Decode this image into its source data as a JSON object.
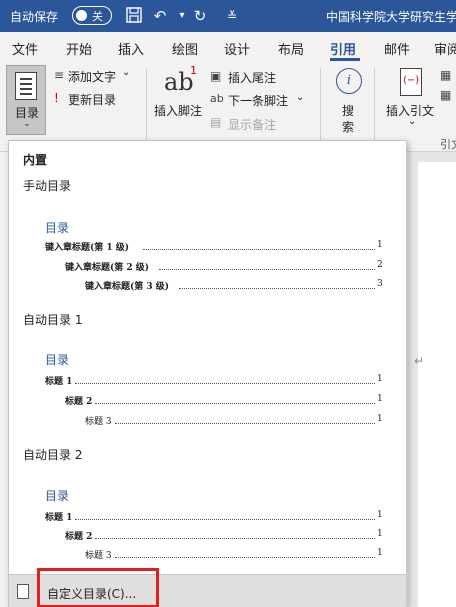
{
  "titlebar": {
    "autosave_label": "自动保存",
    "toggle_label": "关",
    "doc_title": "中国科学院大学研究生学"
  },
  "tabs": [
    "文件",
    "开始",
    "插入",
    "绘图",
    "设计",
    "布局",
    "引用",
    "邮件",
    "审阅"
  ],
  "active_tab": "引用",
  "ribbon": {
    "toc_label": "目录",
    "add_text": "添加文字",
    "update_toc": "更新目录",
    "insert_footnote": "插入脚注",
    "insert_endnote": "插入尾注",
    "next_footnote": "下一条脚注",
    "show_notes": "显示备注",
    "search": "搜\n索",
    "search_a": "搜",
    "search_b": "索",
    "insert_citation": "插入引文",
    "cite_group": "引文"
  },
  "gallery": {
    "builtin": "内置",
    "manual": {
      "name": "手动目录",
      "title": "目录",
      "lines": [
        {
          "text": "键入章标题(第 1 级)",
          "page": "1"
        },
        {
          "text": "键入章标题(第 2 级)",
          "page": "2"
        },
        {
          "text": "键入章标题(第 3 级)",
          "page": "3"
        }
      ]
    },
    "auto1": {
      "name": "自动目录 1",
      "title": "目录",
      "lines": [
        {
          "text": "标题 1",
          "page": "1"
        },
        {
          "text": "标题 2",
          "page": "1"
        },
        {
          "text": "标题 3",
          "page": "1"
        }
      ]
    },
    "auto2": {
      "name": "自动目录 2",
      "title": "目录",
      "lines": [
        {
          "text": "标题 1",
          "page": "1"
        },
        {
          "text": "标题 2",
          "page": "1"
        },
        {
          "text": "标题 3",
          "page": "1"
        }
      ]
    },
    "custom_label": "自定义目录(C)..."
  },
  "colors": {
    "word_blue": "#2b579a",
    "highlight_red": "#e02020"
  }
}
